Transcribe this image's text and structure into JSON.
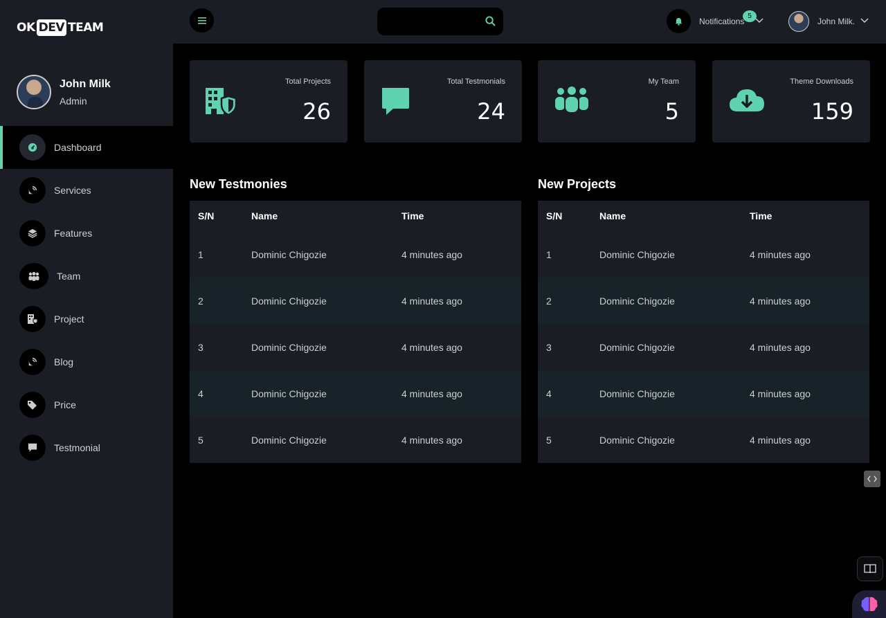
{
  "brand": {
    "logo_left": "OK",
    "logo_box": "DEV",
    "logo_right": "TEAM"
  },
  "profile": {
    "name": "John Milk",
    "role": "Admin"
  },
  "sidebar": {
    "items": [
      {
        "label": "Dashboard",
        "icon": "dashboard-icon",
        "active": true
      },
      {
        "label": "Services",
        "icon": "satellite-dish-icon"
      },
      {
        "label": "Features",
        "icon": "layers-icon"
      },
      {
        "label": "Team",
        "icon": "people-group-icon"
      },
      {
        "label": "Project",
        "icon": "building-shield-icon"
      },
      {
        "label": "Blog",
        "icon": "satellite-dish-icon"
      },
      {
        "label": "Price",
        "icon": "tags-icon"
      },
      {
        "label": "Testmonial",
        "icon": "comment-icon"
      }
    ]
  },
  "topbar": {
    "search_placeholder": "",
    "notifications_label": "Notifications",
    "notifications_count": "5",
    "user_label": "John Milk."
  },
  "stats": [
    {
      "title": "Total Projects",
      "value": "26",
      "icon": "building-shield-icon"
    },
    {
      "title": "Total Testmonials",
      "value": "24",
      "icon": "comment-icon"
    },
    {
      "title": "My Team",
      "value": "5",
      "icon": "people-group-icon"
    },
    {
      "title": "Theme Downloads",
      "value": "159",
      "icon": "cloud-download-icon"
    }
  ],
  "testimonies": {
    "title": "New Testmonies",
    "headers": [
      "S/N",
      "Name",
      "Time"
    ],
    "rows": [
      [
        "1",
        "Dominic Chigozie",
        "4 minutes ago"
      ],
      [
        "2",
        "Dominic Chigozie",
        "4 minutes ago"
      ],
      [
        "3",
        "Dominic Chigozie",
        "4 minutes ago"
      ],
      [
        "4",
        "Dominic Chigozie",
        "4 minutes ago"
      ],
      [
        "5",
        "Dominic Chigozie",
        "4 minutes ago"
      ]
    ]
  },
  "projects": {
    "title": "New Projects",
    "headers": [
      "S/N",
      "Name",
      "Time"
    ],
    "rows": [
      [
        "1",
        "Dominic Chigozie",
        "4 minutes ago"
      ],
      [
        "2",
        "Dominic Chigozie",
        "4 minutes ago"
      ],
      [
        "3",
        "Dominic Chigozie",
        "4 minutes ago"
      ],
      [
        "4",
        "Dominic Chigozie",
        "4 minutes ago"
      ],
      [
        "5",
        "Dominic Chigozie",
        "4 minutes ago"
      ]
    ]
  },
  "colors": {
    "accent": "#5fd3b0",
    "panel": "#1b1d25",
    "background": "#000000"
  }
}
